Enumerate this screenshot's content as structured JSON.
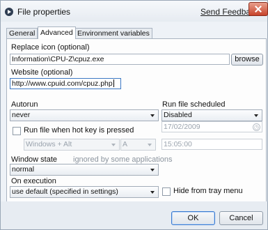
{
  "window": {
    "title": "File properties",
    "feedback_link": "Send Feedback"
  },
  "tabs": [
    {
      "label": "General"
    },
    {
      "label": "Advanced"
    },
    {
      "label": "Environment variables"
    }
  ],
  "advanced": {
    "replace_icon_label": "Replace icon (optional)",
    "replace_icon_value": "Information\\CPU-Z\\cpuz.exe",
    "browse_label": "browse",
    "website_label": "Website (optional)",
    "website_value": "http://www.cpuid.com/cpuz.php",
    "autorun_label": "Autorun",
    "autorun_value": "never",
    "schedule_label": "Run file scheduled",
    "schedule_value": "Disabled",
    "date_value": "17/02/2009",
    "time_value": "15:05:00",
    "hotkey_label": "Run file when hot key is pressed",
    "hotkey_modifier": "Windows + Alt",
    "hotkey_key": "A",
    "window_state_label": "Window state",
    "window_state_note": "ignored by some applications",
    "window_state_value": "normal",
    "on_execution_label": "On execution",
    "on_execution_value": "use default (specified in settings)",
    "hide_tray_label": "Hide from tray menu"
  },
  "footer": {
    "ok_label": "OK",
    "cancel_label": "Cancel"
  }
}
